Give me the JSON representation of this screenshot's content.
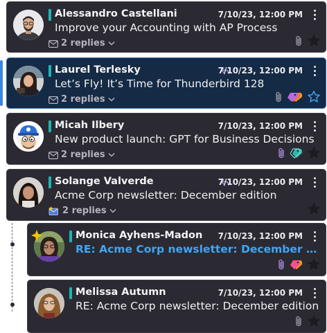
{
  "messages": [
    {
      "sender": "Alessandro Castellani",
      "date": "7/10/23, 12:00 PM",
      "subject": "Improve your Accounting with AP Process",
      "replies": "2 replies"
    },
    {
      "sender": "Laurel Terlesky",
      "date": "7/10/23, 12:00 PM",
      "subject": "Let’s Fly! It’s Time for Thunderbird 128",
      "replies": "2 replies"
    },
    {
      "sender": "Micah Ilbery",
      "date": "7/10/23, 12:00 PM",
      "subject": "New product launch: GPT for Business Decisions",
      "replies": "2 replies"
    },
    {
      "sender": "Solange Valverde",
      "date": "7/10/23, 12:00 PM",
      "subject": "Acme Corp newsletter: December edition",
      "replies": "2 replies"
    },
    {
      "sender": "Monica Ayhens-Madon",
      "date": "7/10/23, 12:00 PM",
      "subject": "RE: Acme Corp newsletter: December edition"
    },
    {
      "sender": "Melissa Autumn",
      "date": "7/10/23, 12:00 PM",
      "subject": "RE: Acme Corp newsletter: December edition"
    }
  ],
  "colors": {
    "card_bg": "#2b2a33",
    "selected_bg": "#152a45",
    "selected_border": "#2f6fb0",
    "tag_teal": "#1fb4b4",
    "unread_blue": "#3fa6f5",
    "reply_purple": "#a98bdc"
  }
}
